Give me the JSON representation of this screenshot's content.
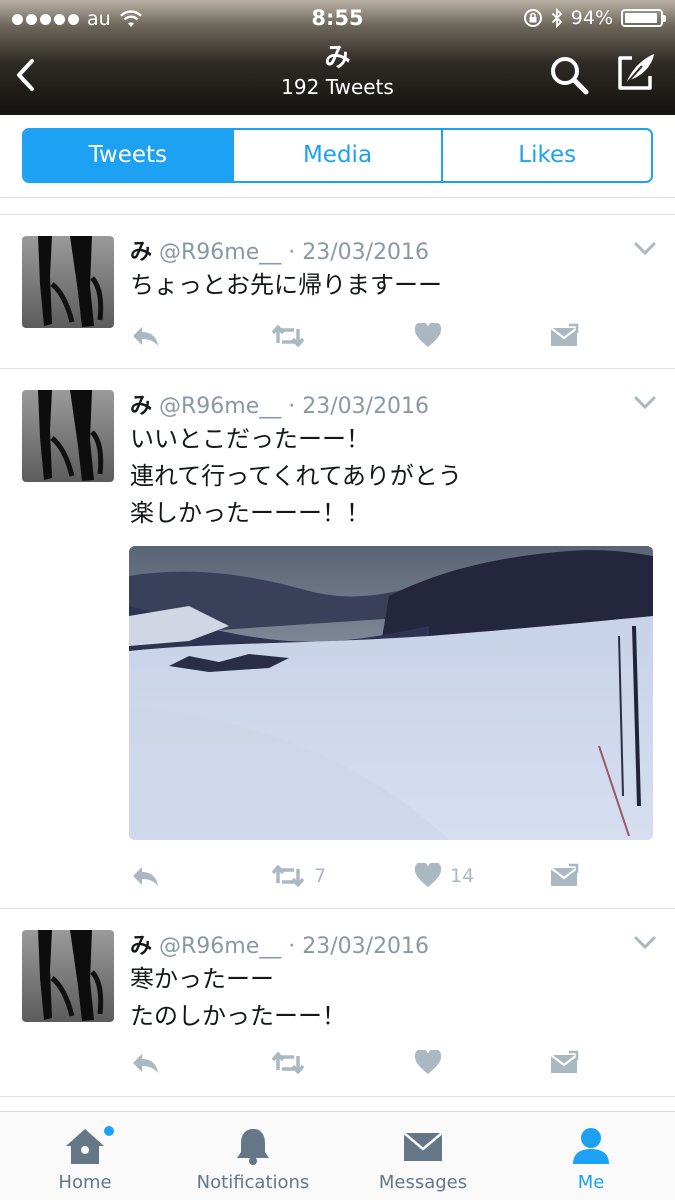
{
  "status_bar": {
    "carrier": "au",
    "time": "8:55",
    "battery": "94%",
    "battery_level": 0.94,
    "icons": [
      "signal-dots-icon",
      "wifi-icon",
      "orientation-lock-icon",
      "bluetooth-icon",
      "battery-icon"
    ]
  },
  "header": {
    "name": "み",
    "tweet_count": "192 Tweets",
    "icons": [
      "back-chevron-icon",
      "search-icon",
      "compose-icon"
    ]
  },
  "tabs": [
    {
      "label": "Tweets",
      "active": true
    },
    {
      "label": "Media",
      "active": false
    },
    {
      "label": "Likes",
      "active": false
    }
  ],
  "tweets": [
    {
      "name": "み",
      "handle": "@R96me__",
      "date": "· 23/03/2016",
      "text": "ちょっとお先に帰りますーー",
      "has_media": false,
      "retweets": "",
      "likes": ""
    },
    {
      "name": "み",
      "handle": "@R96me__",
      "date": "· 23/03/2016",
      "text": "いいとこだったーー！\n連れて行ってくれてありがとう\n楽しかったーーー！！",
      "has_media": true,
      "retweets": "7",
      "likes": "14"
    },
    {
      "name": "み",
      "handle": "@R96me__",
      "date": "· 23/03/2016",
      "text": "寒かったーー\nたのしかったーー！",
      "has_media": false,
      "retweets": "",
      "likes": ""
    }
  ],
  "tab_bar": [
    {
      "label": "Home",
      "icon": "home-icon",
      "active": false,
      "badge": true
    },
    {
      "label": "Notifications",
      "icon": "bell-icon",
      "active": false,
      "badge": false
    },
    {
      "label": "Messages",
      "icon": "envelope-icon",
      "active": false,
      "badge": false
    },
    {
      "label": "Me",
      "icon": "person-icon",
      "active": true,
      "badge": false
    }
  ],
  "colors": {
    "accent": "#1da1f2",
    "icon_gray": "#aab8c2",
    "text_dark": "#14171a",
    "text_gray": "#8899a6"
  }
}
